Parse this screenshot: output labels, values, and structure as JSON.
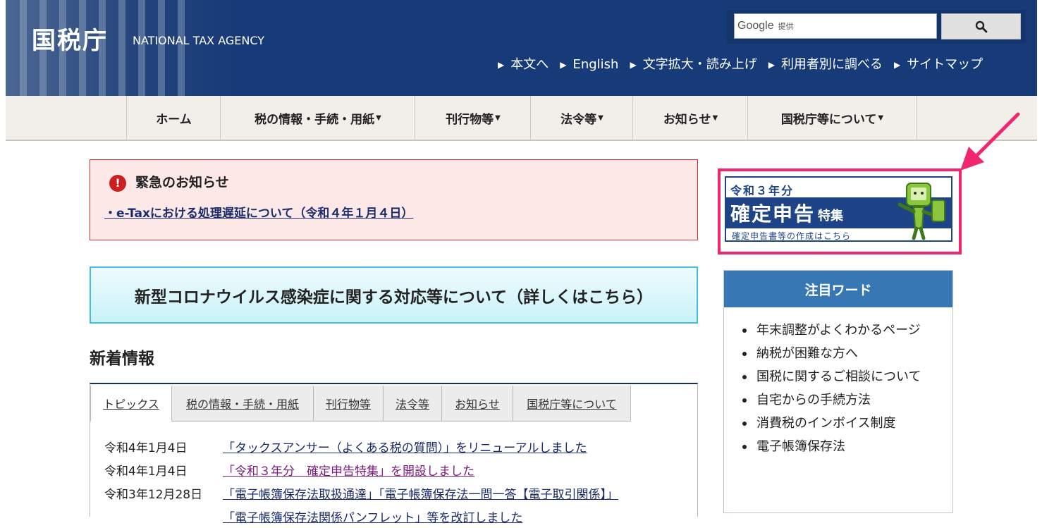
{
  "header": {
    "site_title": "国税庁",
    "site_subtitle": "NATIONAL TAX AGENCY",
    "search": {
      "brand": "Google",
      "provided": "提供",
      "placeholder": ""
    },
    "utility_links": [
      "本文へ",
      "English",
      "文字拡大・読み上げ",
      "利用者別に調べる",
      "サイトマップ"
    ]
  },
  "global_nav": [
    "ホーム",
    "税の情報・手続・用紙",
    "刊行物等",
    "法令等",
    "お知らせ",
    "国税庁等について"
  ],
  "alert": {
    "title": "緊急のお知らせ",
    "link": "・e-Taxにおける処理遅延について（令和４年１月４日）"
  },
  "covid_banner": "新型コロナウイルス感染症に関する対応等について（詳しくはこちら）",
  "news": {
    "heading": "新着情報",
    "tabs": [
      "トピックス",
      "税の情報・手続・用紙",
      "刊行物等",
      "法令等",
      "お知らせ",
      "国税庁等について"
    ],
    "items": [
      {
        "date": "令和4年1月4日",
        "title": "「タックスアンサー（よくある税の質問）」をリニューアルしました"
      },
      {
        "date": "令和4年1月4日",
        "title": "「令和３年分　確定申告特集」を開設しました"
      },
      {
        "date": "令和3年12月28日",
        "title": "「電子帳簿保存法取扱通達」「電子帳簿保存法一問一答【電子取引関係】」"
      },
      {
        "date": "",
        "title": "「電子帳簿保存法関係パンフレット」等を改訂しました"
      }
    ]
  },
  "sidebar": {
    "banner": {
      "year": "令和３年分",
      "main": "確定申告",
      "suffix": "特集",
      "sub": "確定申告書等の作成はこちら"
    },
    "attention": {
      "heading": "注目ワード",
      "items": [
        "年末調整がよくわかるページ",
        "納税が困難な方へ",
        "国税に関するご相談について",
        "自宅からの手続方法",
        "消費税のインボイス制度",
        "電子帳簿保存法"
      ]
    }
  },
  "colors": {
    "header_bg": "#173b78",
    "nav_bg": "#f2efeb",
    "alert_bg": "#fde8e8",
    "alert_border": "#c9342f",
    "covid_border": "#41c0dc",
    "attention_head": "#3778b4",
    "highlight": "#f0276f",
    "link": "#1a2b6b"
  }
}
